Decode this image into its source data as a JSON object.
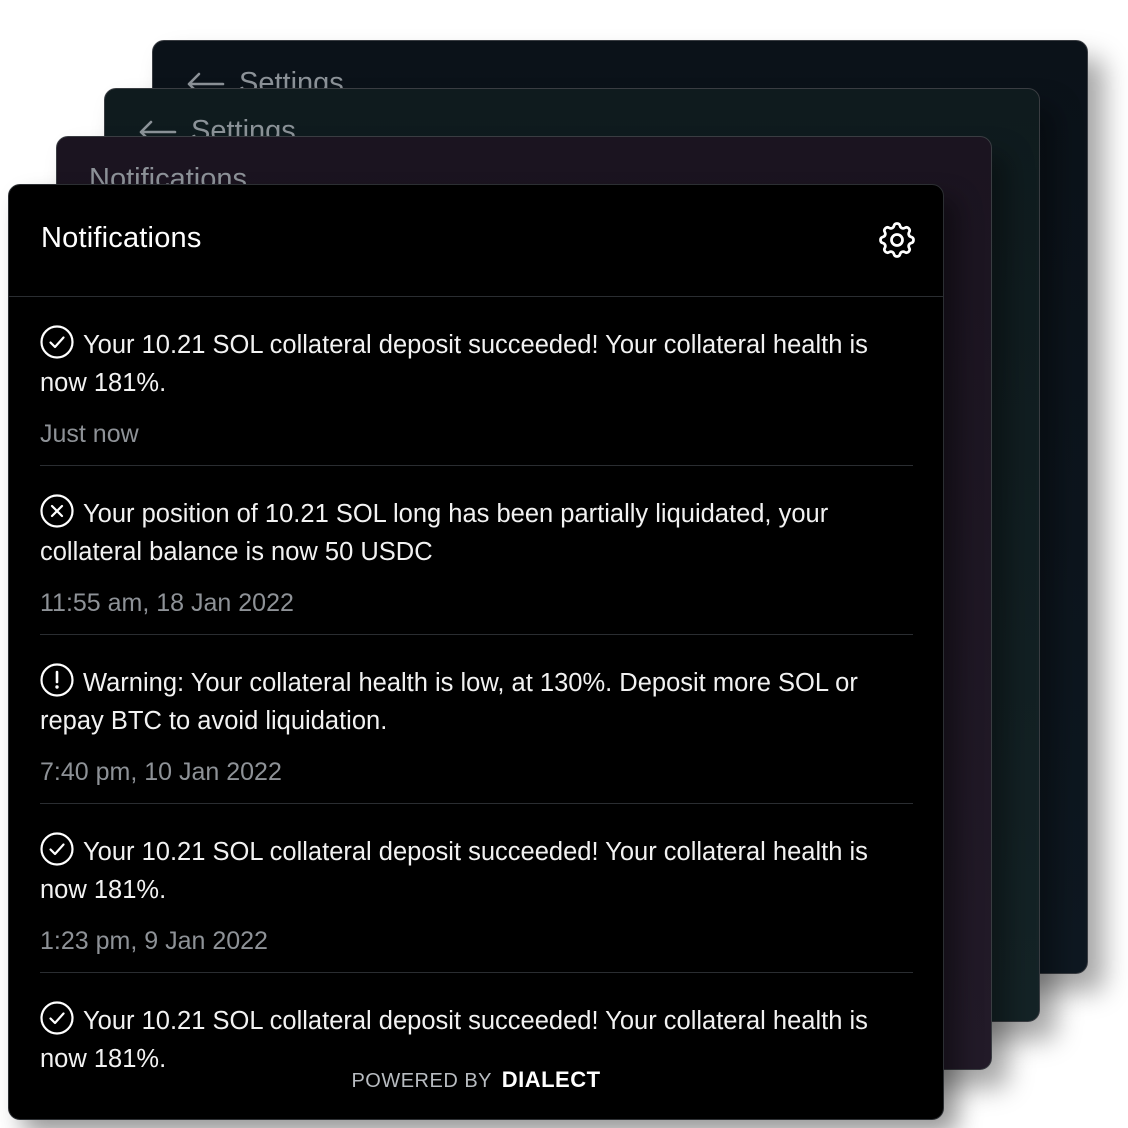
{
  "stack": {
    "card_4": {
      "title": "Settings"
    },
    "card_3": {
      "title": "Settings"
    },
    "card_2": {
      "title": "Notifications"
    }
  },
  "panel": {
    "title": "Notifications",
    "settings_icon": "gear-icon"
  },
  "notifications": [
    {
      "icon": "check-circle-icon",
      "message": "Your 10.21 SOL collateral deposit succeeded! Your collateral health is now 181%.",
      "time": "Just now"
    },
    {
      "icon": "x-circle-icon",
      "message": "Your position of 10.21 SOL long has been partially liquidated, your collateral balance is now 50 USDC",
      "time": "11:55 am, 18 Jan 2022"
    },
    {
      "icon": "exclamation-circle-icon",
      "message": "Warning: Your collateral health is low, at 130%. Deposit more SOL or repay BTC to avoid liquidation.",
      "time": "7:40 pm, 10 Jan 2022"
    },
    {
      "icon": "check-circle-icon",
      "message": "Your 10.21 SOL collateral deposit succeeded! Your collateral health is now 181%.",
      "time": "1:23 pm, 9 Jan 2022"
    },
    {
      "icon": "check-circle-icon",
      "message": "Your 10.21 SOL collateral deposit succeeded! Your collateral health is now 181%.",
      "time": ""
    }
  ],
  "footer": {
    "powered_by": "POWERED BY",
    "brand": "DIALECT"
  }
}
